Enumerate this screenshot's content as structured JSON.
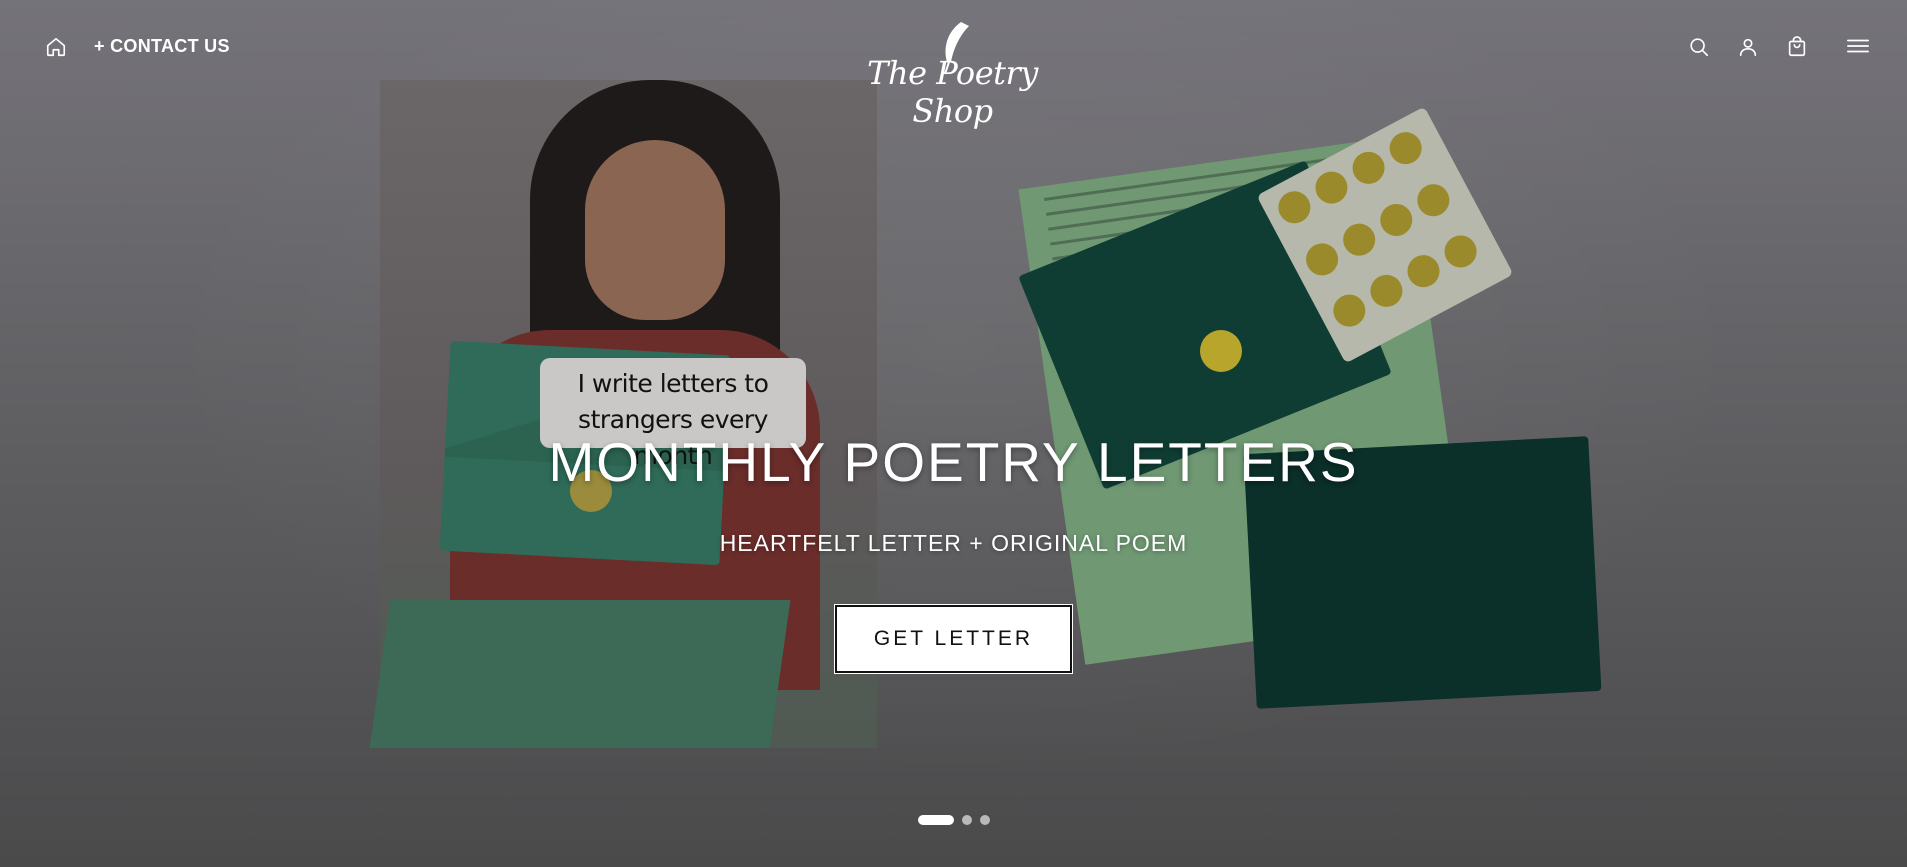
{
  "header": {
    "contact_label": "+ CONTACT US",
    "logo_text": "The Poetry Shop"
  },
  "icons": {
    "home": "home-icon",
    "search": "search-icon",
    "account": "user-icon",
    "cart": "shopping-bag-icon",
    "menu": "hamburger-menu-icon"
  },
  "hero": {
    "photo_caption": "I write letters to strangers every month",
    "title": "MONTHLY POETRY LETTERS",
    "subtitle": "HEARTFELT LETTER + ORIGINAL POEM",
    "cta_label": "GET LETTER"
  },
  "slider": {
    "slides": 3,
    "active_index": 0
  },
  "colors": {
    "text": "#ffffff",
    "button_bg": "#ffffff",
    "button_text": "#111111",
    "dot_inactive": "#b9b9b9"
  }
}
